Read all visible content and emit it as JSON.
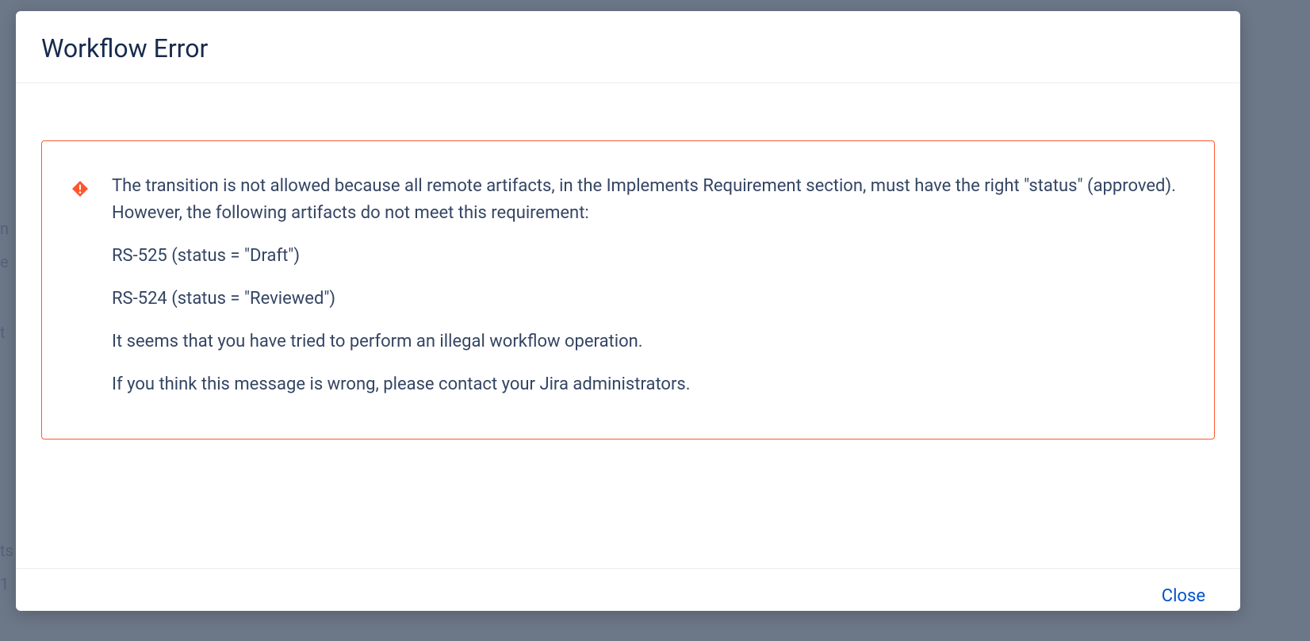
{
  "modal": {
    "title": "Workflow Error",
    "error": {
      "intro": "The transition is not allowed because all remote artifacts, in the Implements Requirement section, must have the right \"status\" (approved). However, the following artifacts do not meet this requirement:",
      "artifacts": [
        "RS-525 (status = \"Draft\")",
        "RS-524 (status = \"Reviewed\")"
      ],
      "illegal_op": "It seems that you have tried to perform an illegal workflow operation.",
      "contact_admin": "If you think this message is wrong, please contact your Jira administrators."
    },
    "close_label": "Close"
  },
  "backdrop": {
    "text_n": "n",
    "text_e": "e",
    "text_t": "t",
    "text_ts": "ts",
    "text_1": "1"
  }
}
